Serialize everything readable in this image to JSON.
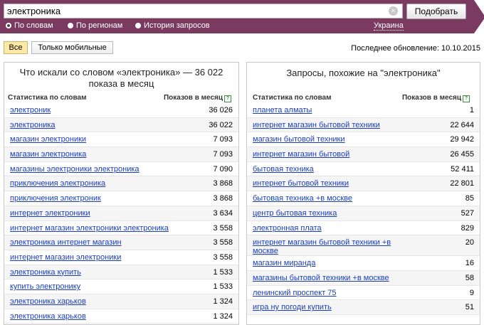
{
  "search": {
    "query": "электроника",
    "clear_glyph": "×",
    "submit_label": "Подобрать"
  },
  "modes": [
    {
      "label": "По словам",
      "selected": true
    },
    {
      "label": "По регионам",
      "selected": false
    },
    {
      "label": "История запросов",
      "selected": false
    }
  ],
  "region": "Украина",
  "filters": [
    {
      "label": "Все",
      "active": true
    },
    {
      "label": "Только мобильные",
      "active": false
    }
  ],
  "updated": "Последнее обновление: 10.10.2015",
  "left_panel": {
    "title": "Что искали со словом «электроника» — 36 022 показа в месяц",
    "col_phrase": "Статистика по словам",
    "col_count": "Показов в месяц",
    "help_glyph": "?",
    "rows": [
      {
        "phrase": "электроник",
        "count": "36 026"
      },
      {
        "phrase": "электроника",
        "count": "36 022"
      },
      {
        "phrase": "магазин электроники",
        "count": "7 093"
      },
      {
        "phrase": "магазин электроника",
        "count": "7 093"
      },
      {
        "phrase": "магазины электроники электроника",
        "count": "7 090"
      },
      {
        "phrase": "приключения электроника",
        "count": "3 868"
      },
      {
        "phrase": "приключения электроник",
        "count": "3 868"
      },
      {
        "phrase": "интернет электроники",
        "count": "3 634"
      },
      {
        "phrase": "интернет магазин электроники электроника",
        "count": "3 558"
      },
      {
        "phrase": "электроника интернет магазин",
        "count": "3 558"
      },
      {
        "phrase": "интернет магазин электроники",
        "count": "3 558"
      },
      {
        "phrase": "электроника купить",
        "count": "1 533"
      },
      {
        "phrase": "купить электронику",
        "count": "1 533"
      },
      {
        "phrase": "электроника харьков",
        "count": "1 324"
      },
      {
        "phrase": "электроника харьков",
        "count": "1 324"
      }
    ]
  },
  "right_panel": {
    "title": "Запросы, похожие на \"электроника\"",
    "col_phrase": "Статистика по словам",
    "col_count": "Показов в месяц",
    "help_glyph": "?",
    "rows": [
      {
        "phrase": "планета алматы",
        "count": "1"
      },
      {
        "phrase": "интернет магазин бытовой техники",
        "count": "22 644"
      },
      {
        "phrase": "магазин бытовой техники",
        "count": "29 942"
      },
      {
        "phrase": "интернет магазин бытовой",
        "count": "26 455"
      },
      {
        "phrase": "бытовая техника",
        "count": "52 411"
      },
      {
        "phrase": "интернет бытовой техники",
        "count": "22 801"
      },
      {
        "phrase": "бытовая техника +в москве",
        "count": "85"
      },
      {
        "phrase": "центр бытовая техника",
        "count": "527"
      },
      {
        "phrase": "электронная плата",
        "count": "829"
      },
      {
        "phrase": "интернет магазин бытовой техники +в москве",
        "count": "20"
      },
      {
        "phrase": "магазин миранда",
        "count": "16"
      },
      {
        "phrase": "магазины бытовой техники +в москве",
        "count": "58"
      },
      {
        "phrase": "ленинский проспект 75",
        "count": "9"
      },
      {
        "phrase": "игра ну погоди купить",
        "count": "51"
      }
    ]
  }
}
